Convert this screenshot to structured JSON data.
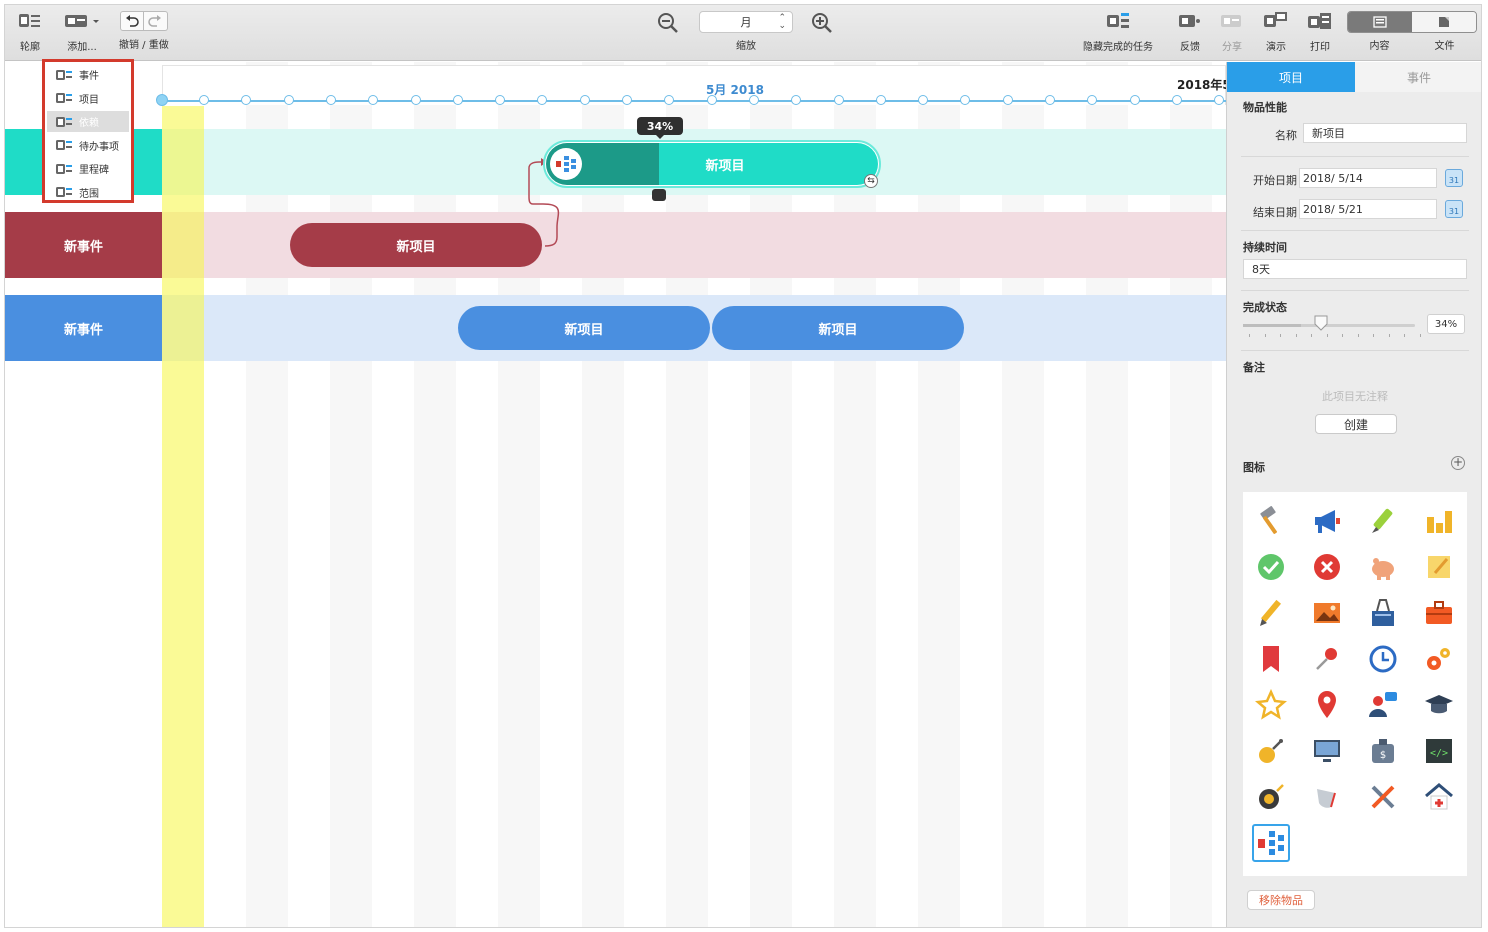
{
  "toolbar": {
    "outline_label": "轮廓",
    "add_label": "添加...",
    "undo_redo_label": "撤销 / 重做",
    "zoom_value": "月",
    "zoom_label": "缩放",
    "hide_done_label": "隐藏完成的任务",
    "feedback_label": "反馈",
    "share_label": "分享",
    "present_label": "演示",
    "print_label": "打印",
    "content_label": "内容",
    "file_label": "文件"
  },
  "add_menu": {
    "items": [
      "事件",
      "项目",
      "依赖",
      "待办事项",
      "里程碑",
      "范围"
    ],
    "selected_index": 2
  },
  "timeline": {
    "month_label": "5月 2018",
    "year_label": "2018年5",
    "progress_badge": "34%"
  },
  "rows": [
    {
      "label": "",
      "color": "#1fdcc7",
      "body_color": "#dcf8f4"
    },
    {
      "label": "新事件",
      "color": "#a53c48",
      "body_color": "#f2dce1"
    },
    {
      "label": "新事件",
      "color": "#4a8fe0",
      "body_color": "#dbe8f9"
    }
  ],
  "items": {
    "teal_item": "新项目",
    "red_item": "新项目",
    "blue_item_1": "新项目",
    "blue_item_2": "新项目"
  },
  "panel": {
    "tab_project": "项目",
    "tab_event": "事件",
    "section_properties": "物品性能",
    "name_label": "名称",
    "name_value": "新项目",
    "start_label": "开始日期",
    "start_value": "2018/  5/14",
    "end_label": "结束日期",
    "end_value": "2018/  5/21",
    "calendar_day": "31",
    "duration_title": "持续时间",
    "duration_value": "8天",
    "completion_title": "完成状态",
    "completion_value": "34%",
    "completion_fraction": 0.34,
    "notes_title": "备注",
    "notes_empty": "此项目无注释",
    "create_button": "创建",
    "icons_title": "图标",
    "icons": [
      "hammer-icon",
      "megaphone-icon",
      "highlighter-icon",
      "bar-chart-icon",
      "check-icon",
      "cross-icon",
      "piggy-bank-icon",
      "note-icon",
      "pencil-icon",
      "picture-icon",
      "binder-clip-icon",
      "briefcase-icon",
      "bookmark-icon",
      "pushpin-icon",
      "clock-icon",
      "gears-icon",
      "star-icon",
      "location-pin-icon",
      "user-chat-icon",
      "graduation-cap-icon",
      "satellite-icon",
      "monitor-icon",
      "money-bag-icon",
      "code-icon",
      "tape-measure-icon",
      "bulb-icon",
      "tools-icon",
      "home-medical-icon",
      "hierarchy-icon"
    ],
    "remove_button": "移除物品"
  },
  "colors": {
    "accent": "#2a9ee8",
    "teal_dark": "#1c9a88",
    "teal": "#1fdcc7",
    "red": "#a53c48",
    "blue": "#4a8fe0",
    "highlight_box": "#d33a2c"
  }
}
